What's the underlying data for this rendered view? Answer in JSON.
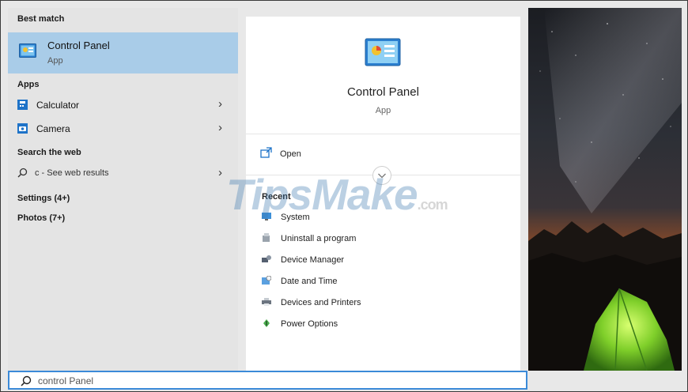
{
  "left_pane": {
    "best_match_header": "Best match",
    "best_match": {
      "title": "Control Panel",
      "subtitle": "App"
    },
    "apps_header": "Apps",
    "apps": [
      {
        "label": "Calculator",
        "icon": "calculator-icon"
      },
      {
        "label": "Camera",
        "icon": "camera-icon"
      }
    ],
    "search_web_header": "Search the web",
    "web_result": {
      "label": "c - See web results",
      "icon": "search-icon"
    },
    "settings_header": "Settings (4+)",
    "photos_header": "Photos (7+)"
  },
  "detail": {
    "app_name": "Control Panel",
    "app_type": "App",
    "open_label": "Open",
    "recent_header": "Recent",
    "recent": [
      {
        "label": "System",
        "icon": "system-icon"
      },
      {
        "label": "Uninstall a program",
        "icon": "uninstall-icon"
      },
      {
        "label": "Device Manager",
        "icon": "device-manager-icon"
      },
      {
        "label": "Date and Time",
        "icon": "date-time-icon"
      },
      {
        "label": "Devices and Printers",
        "icon": "printer-icon"
      },
      {
        "label": "Power Options",
        "icon": "power-icon"
      }
    ]
  },
  "watermark": {
    "main": "TipsMake",
    "suffix": ".com"
  },
  "search": {
    "value": "control Panel"
  },
  "colors": {
    "accent": "#3b8ad8",
    "selection": "#a9cce8"
  }
}
